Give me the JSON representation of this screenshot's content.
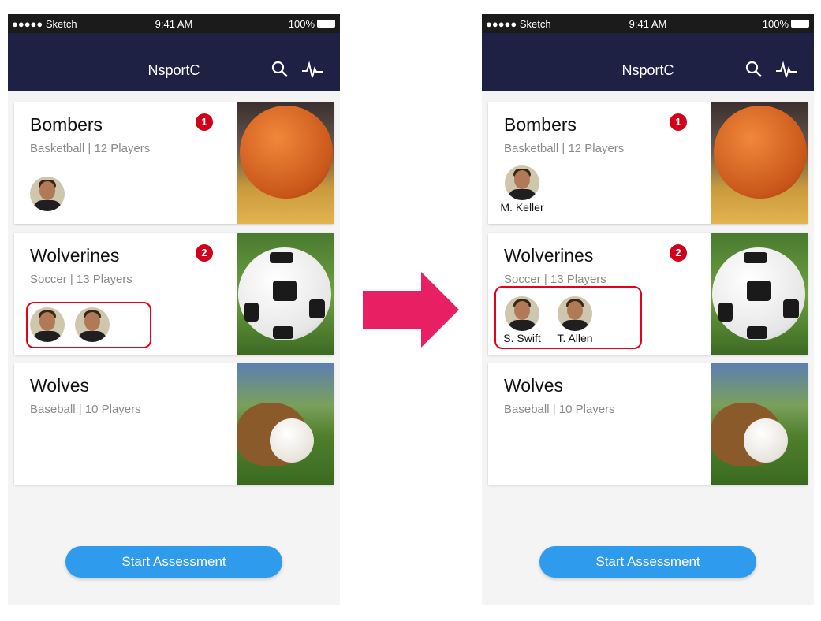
{
  "colors": {
    "nav": "#1e2044",
    "badge": "#d0021b",
    "button": "#2e9bed",
    "highlight": "#e5001b",
    "arrow": "#e81f63"
  },
  "screens": [
    {
      "status": {
        "carrier": "●●●●● Sketch",
        "time": "9:41 AM",
        "battery": "100%"
      },
      "nav": {
        "title": "NsportC",
        "icons": [
          "search-icon",
          "activity-pulse-icon"
        ]
      },
      "teams": [
        {
          "name": "Bombers",
          "sub": "Basketball | 12 Players",
          "badge": "1",
          "image": "basketball",
          "players": [
            {
              "name": ""
            }
          ]
        },
        {
          "name": "Wolverines",
          "sub": "Soccer | 13 Players",
          "badge": "2",
          "image": "soccer-ball",
          "players": [
            {
              "name": ""
            },
            {
              "name": ""
            }
          ],
          "highlight": true
        },
        {
          "name": "Wolves",
          "sub": "Baseball | 10 Players",
          "image": "baseball-glove",
          "players": []
        }
      ],
      "button": "Start Assessment"
    },
    {
      "status": {
        "carrier": "●●●●● Sketch",
        "time": "9:41 AM",
        "battery": "100%"
      },
      "nav": {
        "title": "NsportC",
        "icons": [
          "search-icon",
          "activity-pulse-icon"
        ]
      },
      "teams": [
        {
          "name": "Bombers",
          "sub": "Basketball | 12 Players",
          "badge": "1",
          "image": "basketball",
          "players": [
            {
              "name": "M. Keller"
            }
          ]
        },
        {
          "name": "Wolverines",
          "sub": "Soccer | 13 Players",
          "badge": "2",
          "image": "soccer-ball",
          "players": [
            {
              "name": "S. Swift"
            },
            {
              "name": "T. Allen"
            }
          ],
          "highlight": true
        },
        {
          "name": "Wolves",
          "sub": "Baseball | 10 Players",
          "image": "baseball-glove",
          "players": []
        }
      ],
      "button": "Start Assessment"
    }
  ]
}
